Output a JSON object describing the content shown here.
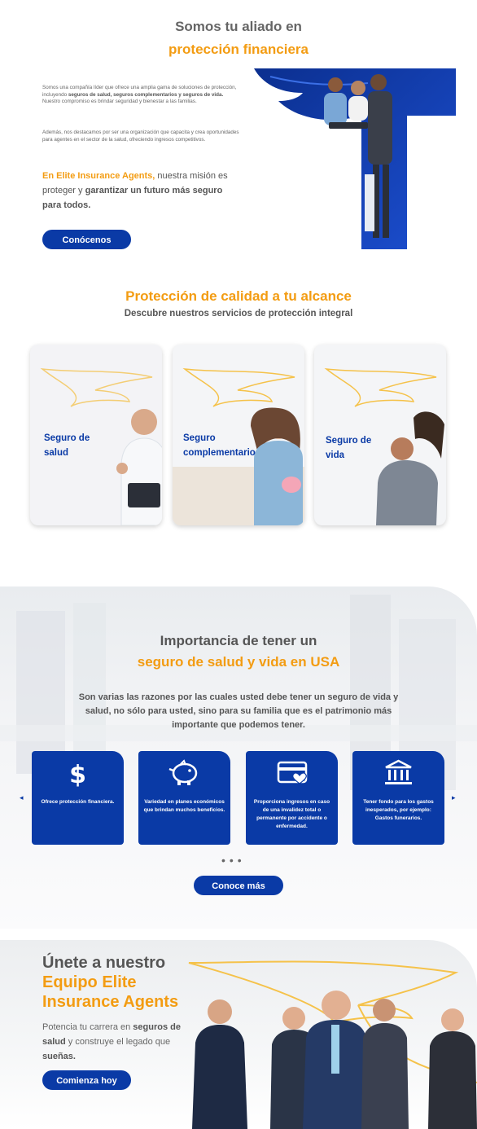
{
  "about": {
    "title_line1": "Somos tu aliado en",
    "title_line2": "protección financiera",
    "para1_a": "Somos una compañía líder que ofrece una amplia gama de soluciones de protección, incluyendo ",
    "para1_b": "seguros de salud, seguros complementarios y seguros de vida.",
    "para1_c": " Nuestro compromiso es brindar seguridad y bienestar a las familias.",
    "para2": "Además, nos destacamos por ser una organización que capacita y crea oportunidades para agentes en el sector de la salud, ofreciendo ingresos competitivos.",
    "mission_a": "En Elite Insurance Agents,",
    "mission_b": " nuestra misión es proteger y ",
    "mission_c": "garantizar un futuro más seguro para todos.",
    "button": "Conócenos"
  },
  "services": {
    "title": "Protección de calidad a tu alcance",
    "subtitle": "Descubre nuestros servicios de protección integral",
    "cards": [
      {
        "label": "Seguro de salud"
      },
      {
        "label": "Seguro complementario"
      },
      {
        "label": "Seguro de vida"
      }
    ]
  },
  "importance": {
    "title_line1": "Importancia de tener un",
    "title_line2": "seguro de salud y vida en USA",
    "text": "Son varias las razones por las cuales usted debe tener un seguro de vida y salud, no sólo para usted, sino para su familia que es el patrimonio más importante que podemos tener.",
    "features": [
      {
        "icon": "dollar-icon",
        "text": "Ofrece protección financiera."
      },
      {
        "icon": "piggy-bank-icon",
        "text": "Variedad en planes económicos que brindan muchos beneficios."
      },
      {
        "icon": "card-heart-icon",
        "text": "Proporciona ingresos en caso de una invalidez total o permanente por accidente o enfermedad."
      },
      {
        "icon": "bank-icon",
        "text": "Tener fondo para los gastos inesperados, por ejemplo: Gastos funerarios."
      }
    ],
    "prev": "◂",
    "next": "▸",
    "dots": "•••",
    "button": "Conoce más"
  },
  "join": {
    "title_line1": "Únete a nuestro",
    "title_line2": "Equipo Elite",
    "title_line3": "Insurance Agents",
    "para_a": "Potencia tu carrera en ",
    "para_b": "seguros de salud",
    "para_c": " y construye el legado que ",
    "para_d": "sueñas.",
    "button": "Comienza hoy"
  },
  "colors": {
    "brand_blue": "#0a3aa6",
    "accent_orange": "#f39c12",
    "text_gray": "#555555"
  }
}
